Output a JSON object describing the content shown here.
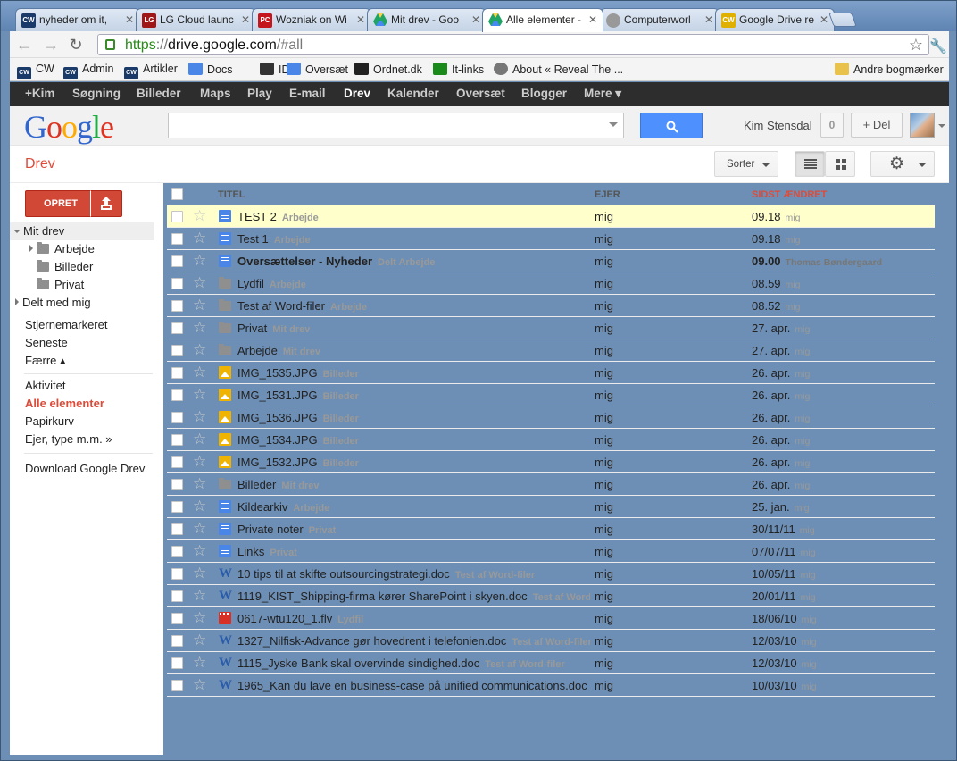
{
  "browser": {
    "tabs": [
      {
        "title": "nyheder om it,",
        "favicon": "CW",
        "color": "#1a3a6a"
      },
      {
        "title": "LG Cloud launc",
        "favicon": "LG",
        "color": "#a01515"
      },
      {
        "title": "Wozniak on Wi",
        "favicon": "PC",
        "color": "#c4161c"
      },
      {
        "title": "Mit drev - Goo",
        "favicon": "drive",
        "color": "#1fa463"
      },
      {
        "title": "Alle elementer -",
        "favicon": "drive",
        "color": "#1fa463"
      },
      {
        "title": "Computerworl",
        "favicon": "globe",
        "color": "#777777"
      },
      {
        "title": "Google Drive re",
        "favicon": "CW",
        "color": "#e0b000"
      }
    ],
    "url": {
      "scheme": "https",
      "sep": "://",
      "host": "drive.google.com",
      "path": "/#all"
    },
    "bookmarks": [
      {
        "label": "CW",
        "icon": "cw-icon",
        "color": "#1a3a6a"
      },
      {
        "label": "Admin",
        "icon": "cw-icon",
        "color": "#1a3a6a"
      },
      {
        "label": "Artikler",
        "icon": "cw-icon",
        "color": "#1a3a6a"
      },
      {
        "label": "Docs",
        "icon": "docs-icon",
        "color": "#4a86e8"
      },
      {
        "label": "IDG",
        "icon": "idg-icon",
        "color": "#333333"
      },
      {
        "label": "Oversæt",
        "icon": "translate-icon",
        "color": "#4a86e8"
      },
      {
        "label": "Ordnet.dk",
        "icon": "ordnet-icon",
        "color": "#222222"
      },
      {
        "label": "It-links",
        "icon": "it-links-icon",
        "color": "#1a8a1a"
      },
      {
        "label": "About « Reveal The ...",
        "icon": "globe-icon",
        "color": "#777777"
      }
    ],
    "other_bookmarks": "Andre bogmærker"
  },
  "gbar": {
    "items": [
      "+Kim",
      "Søgning",
      "Billeder",
      "Maps",
      "Play",
      "E-mail",
      "Drev",
      "Kalender",
      "Oversæt",
      "Blogger",
      "Mere ▾"
    ],
    "selected": "Drev"
  },
  "header": {
    "logo": [
      "G",
      "o",
      "o",
      "g",
      "l",
      "e"
    ],
    "logo_colors": [
      "#3366cc",
      "#dd3322",
      "#ffaa00",
      "#3366cc",
      "#22aa44",
      "#dd3322"
    ],
    "search_placeholder": "",
    "username": "Kim Stensdal",
    "notifications": "0",
    "share_label": "+ Del"
  },
  "appbar": {
    "title": "Drev",
    "sort_label": "Sorter"
  },
  "sidebar": {
    "create_label": "OPRET",
    "my_drive": "Mit drev",
    "folders": [
      "Arbejde",
      "Billeder",
      "Privat"
    ],
    "shared": "Delt med mig",
    "starred": "Stjernemarkeret",
    "recent": "Seneste",
    "fewer": "Færre ▴",
    "activity": "Aktivitet",
    "all_items": "Alle elementer",
    "trash": "Papirkurv",
    "owner_type": "Ejer, type m.m. »",
    "download": "Download Google Drev"
  },
  "columns": {
    "title": "TITEL",
    "owner": "EJER",
    "modified": "SIDST ÆNDRET"
  },
  "accent": "#dd4b39",
  "files": [
    {
      "name": "TEST 2",
      "tag": "Arbejde",
      "type": "doc",
      "owner": "mig",
      "date": "09.18",
      "by": "mig",
      "highlight": true
    },
    {
      "name": "Test 1",
      "tag": "Arbejde",
      "type": "doc",
      "owner": "mig",
      "date": "09.18",
      "by": "mig"
    },
    {
      "name": "Oversættelser - Nyheder",
      "tag": "Delt  Arbejde",
      "type": "doc",
      "owner": "mig",
      "date": "09.00",
      "by": "Thomas Bøndergaard",
      "bold": true
    },
    {
      "name": "Lydfil",
      "tag": "Arbejde",
      "type": "folder",
      "owner": "mig",
      "date": "08.59",
      "by": "mig"
    },
    {
      "name": "Test af Word-filer",
      "tag": "Arbejde",
      "type": "folder",
      "owner": "mig",
      "date": "08.52",
      "by": "mig"
    },
    {
      "name": "Privat",
      "tag": "Mit drev",
      "type": "folder",
      "owner": "mig",
      "date": "27. apr.",
      "by": "mig"
    },
    {
      "name": "Arbejde",
      "tag": "Mit drev",
      "type": "folder",
      "owner": "mig",
      "date": "27. apr.",
      "by": "mig"
    },
    {
      "name": "IMG_1535.JPG",
      "tag": "Billeder",
      "type": "image",
      "owner": "mig",
      "date": "26. apr.",
      "by": "mig"
    },
    {
      "name": "IMG_1531.JPG",
      "tag": "Billeder",
      "type": "image",
      "owner": "mig",
      "date": "26. apr.",
      "by": "mig"
    },
    {
      "name": "IMG_1536.JPG",
      "tag": "Billeder",
      "type": "image",
      "owner": "mig",
      "date": "26. apr.",
      "by": "mig"
    },
    {
      "name": "IMG_1534.JPG",
      "tag": "Billeder",
      "type": "image",
      "owner": "mig",
      "date": "26. apr.",
      "by": "mig"
    },
    {
      "name": "IMG_1532.JPG",
      "tag": "Billeder",
      "type": "image",
      "owner": "mig",
      "date": "26. apr.",
      "by": "mig"
    },
    {
      "name": "Billeder",
      "tag": "Mit drev",
      "type": "folder",
      "owner": "mig",
      "date": "26. apr.",
      "by": "mig"
    },
    {
      "name": "Kildearkiv",
      "tag": "Arbejde",
      "type": "doc",
      "owner": "mig",
      "date": "25. jan.",
      "by": "mig"
    },
    {
      "name": "Private noter",
      "tag": "Privat",
      "type": "doc",
      "owner": "mig",
      "date": "30/11/11",
      "by": "mig"
    },
    {
      "name": "Links",
      "tag": "Privat",
      "type": "doc",
      "owner": "mig",
      "date": "07/07/11",
      "by": "mig"
    },
    {
      "name": "10 tips til at skifte outsourcingstrategi.doc",
      "tag": "Test af Word-filer",
      "type": "word",
      "owner": "mig",
      "date": "10/05/11",
      "by": "mig"
    },
    {
      "name": "1119_KIST_Shipping-firma kører SharePoint i skyen.doc",
      "tag": "Test af Word-filer",
      "type": "word",
      "owner": "mig",
      "date": "20/01/11",
      "by": "mig"
    },
    {
      "name": "0617-wtu120_1.flv",
      "tag": "Lydfil",
      "type": "video",
      "owner": "mig",
      "date": "18/06/10",
      "by": "mig"
    },
    {
      "name": "1327_Nilfisk-Advance gør hovedrent i telefonien.doc",
      "tag": "Test af Word-filer",
      "type": "word",
      "owner": "mig",
      "date": "12/03/10",
      "by": "mig"
    },
    {
      "name": "1115_Jyske Bank skal overvinde sindighed.doc",
      "tag": "Test af Word-filer",
      "type": "word",
      "owner": "mig",
      "date": "12/03/10",
      "by": "mig"
    },
    {
      "name": "1965_Kan du lave en business-case på unified communications.doc",
      "tag": "",
      "type": "word",
      "owner": "mig",
      "date": "10/03/10",
      "by": "mig"
    }
  ]
}
